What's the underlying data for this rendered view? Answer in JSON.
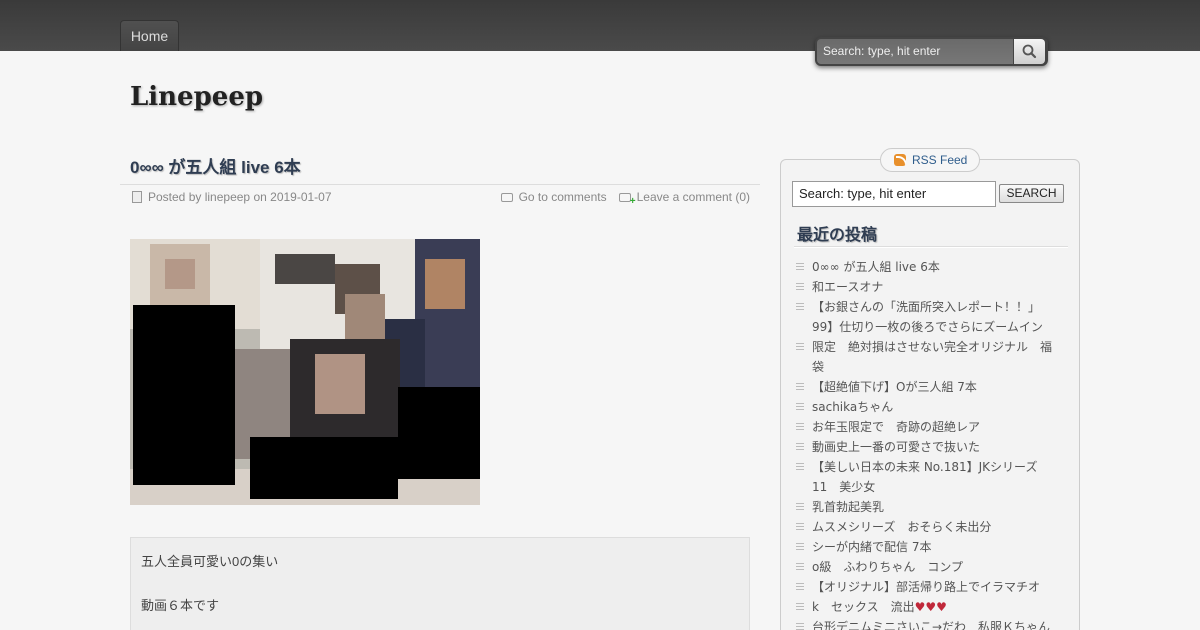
{
  "nav": {
    "home_label": "Home"
  },
  "top_search": {
    "placeholder": "Search: type, hit enter"
  },
  "site": {
    "title": "Linepeep"
  },
  "post": {
    "title": "0∞∞ が五人組 live 6本",
    "meta": {
      "posted_by_prefix": "Posted by",
      "author": "linepeep",
      "on": "on",
      "date": "2019-01-07",
      "go_to_comments": "Go to comments",
      "leave_comment": "Leave a comment (0)"
    },
    "body_lines": [
      "五人全員可愛い0の集い",
      "動画６本です"
    ]
  },
  "sidebar": {
    "rss_label": "RSS Feed",
    "search": {
      "value": "Search: type, hit enter",
      "button_label": "SEARCH"
    },
    "recent_title": "最近の投稿",
    "recent_posts": [
      "0∞∞ が五人組 live 6本",
      "和エースオナ",
      "【お銀さんの「洗面所突入レポート！！」",
      "99】仕切り一枚の後ろでさらにズームイン",
      "限定　絶対損はさせない完全オリジナル　福",
      "袋",
      "【超絶値下げ】Oが三人組 7本",
      "sachikaちゃん",
      "お年玉限定で　奇跡の超絶レア",
      "動画史上一番の可愛さで抜いた",
      "【美しい日本の未来 No.181】JKシリーズ",
      "11　美少女",
      "乳首勃起美乳",
      "ムスメシリーズ　おそらく未出分",
      "シーが内緒で配信 7本",
      "o級　ふわりちゃん　コンプ",
      "【オリジナル】部活帰り路上でイラマチオ",
      "k　セックス　流出",
      "台形デニムミニさいこ→だわ　私服Ｋちゃん"
    ],
    "hearts": "♥♥♥"
  }
}
